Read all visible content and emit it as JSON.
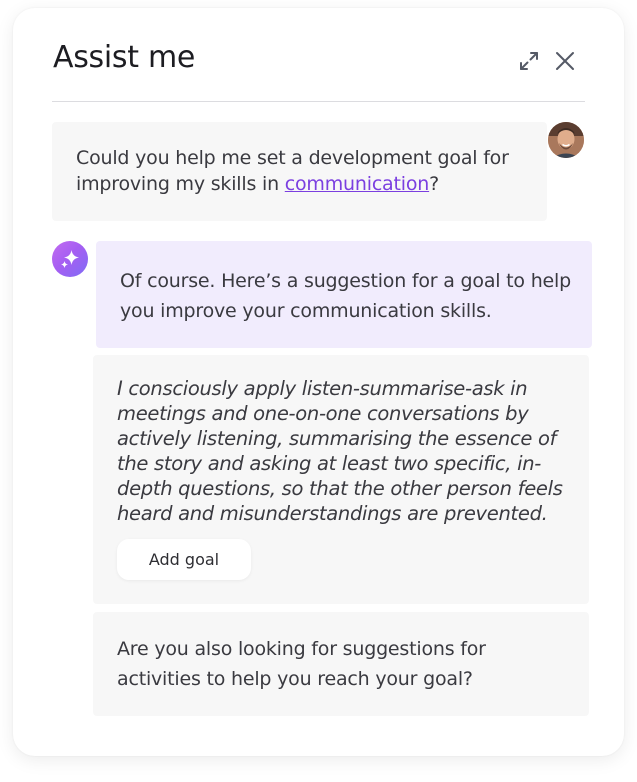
{
  "header": {
    "title": "Assist me",
    "expand_icon": "expand-icon",
    "close_icon": "close-icon"
  },
  "messages": {
    "user": {
      "text_before": "Could you help me set a development goal for improving my skills in ",
      "link": "communication",
      "text_after": "?"
    },
    "assistant_intro": "Of course. Here’s a suggestion for a goal to help you improve your communication skills.",
    "goal_suggestion": "I consciously apply listen-summarise-ask in meetings and one-on-one conversations by actively listening, summarising the essence of the story and asking at least two specific, in-depth questions, so that the other person feels heard and misunderstandings are prevented.",
    "add_goal_label": "Add goal",
    "followup": "Are you also looking for suggestions for activities to help you reach your goal?"
  },
  "colors": {
    "accent": "#7b3fe0",
    "ai_bubble": "#f1ecfd",
    "card_bg": "#f7f7f7"
  }
}
